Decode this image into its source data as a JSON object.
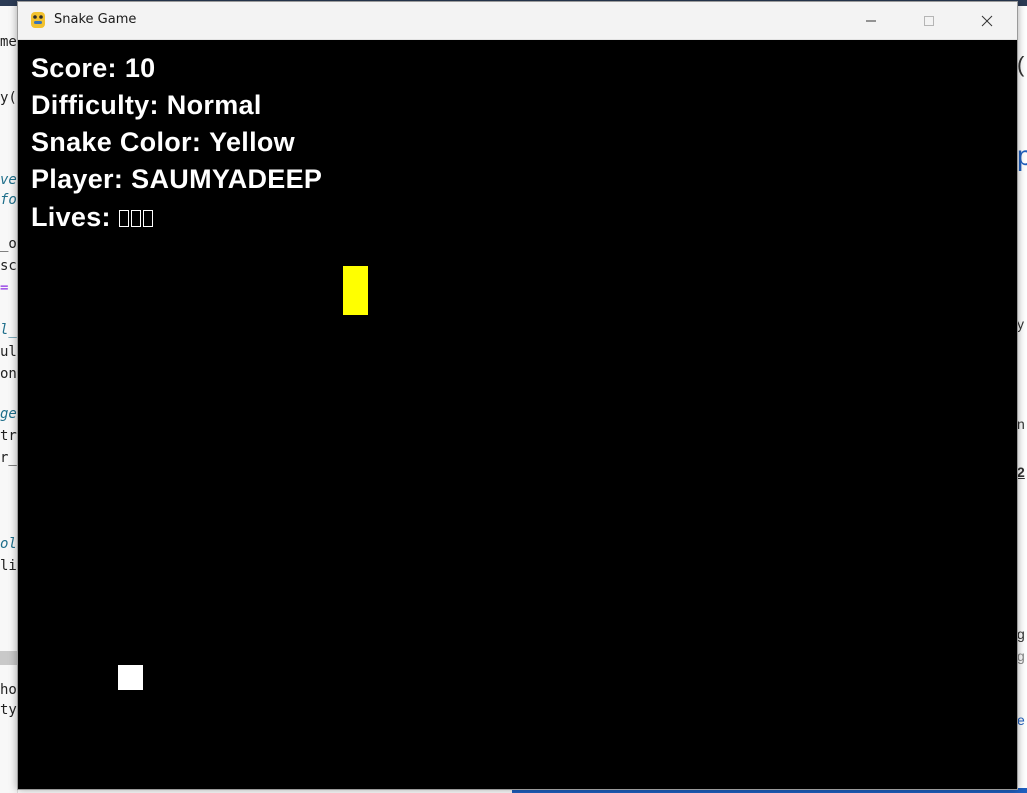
{
  "window": {
    "title": "Snake Game"
  },
  "hud": {
    "score_label": "Score:",
    "score_value": "10",
    "difficulty_label": "Difficulty:",
    "difficulty_value": "Normal",
    "snake_color_label": "Snake Color:",
    "snake_color_value": "Yellow",
    "player_label": "Player:",
    "player_value": "SAUMYADEEP",
    "lives_label": "Lives:",
    "lives_count": 3
  },
  "colors": {
    "snake": "#ffff00",
    "food": "#ffffff",
    "background": "#000000",
    "hud_text": "#ffffff"
  },
  "icons": {
    "app_icon": "python-snake-icon",
    "minimize": "minimize-icon",
    "maximize": "maximize-icon",
    "close": "close-icon"
  },
  "background": {
    "left_lines": [
      "me",
      "y(",
      "ve",
      "fo",
      "_o",
      "sc",
      "=",
      "l_",
      "ul",
      "on",
      "ge",
      "tr",
      "r_",
      "ol",
      "li",
      "ho",
      "ty"
    ],
    "right_lines": [
      "(",
      "p",
      "y",
      "n",
      "2",
      "g",
      "g",
      "e"
    ]
  }
}
